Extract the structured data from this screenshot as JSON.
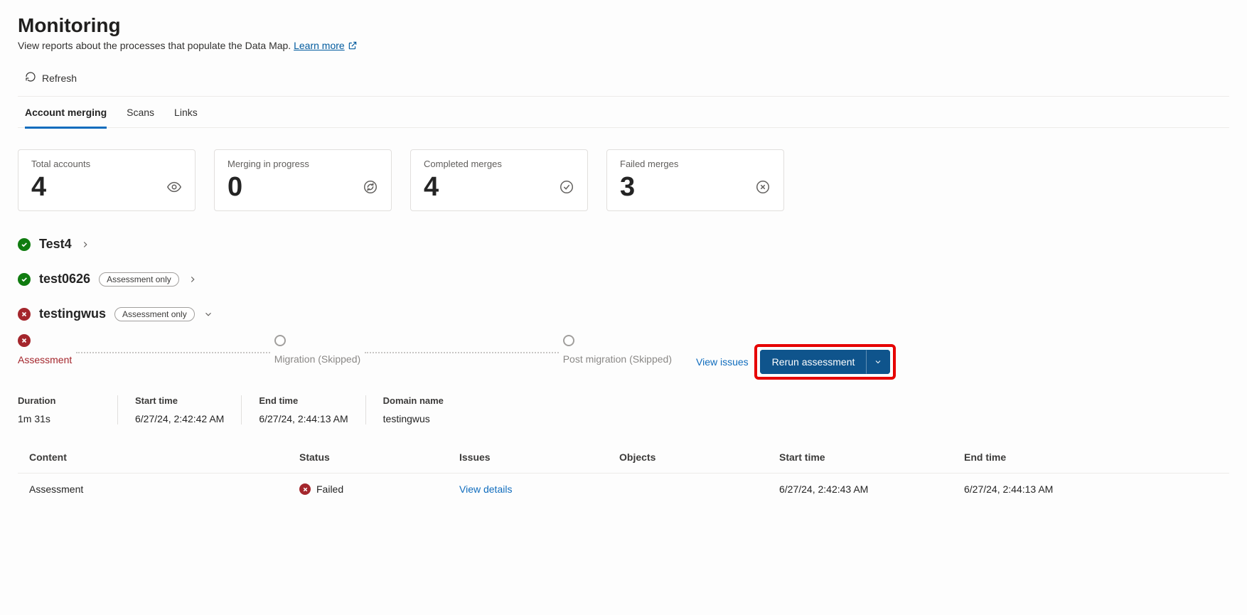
{
  "page": {
    "title": "Monitoring",
    "subtitle": "View reports about the processes that populate the Data Map.",
    "learn_more": "Learn more"
  },
  "toolbar": {
    "refresh": "Refresh"
  },
  "tabs": [
    {
      "label": "Account merging",
      "active": true
    },
    {
      "label": "Scans",
      "active": false
    },
    {
      "label": "Links",
      "active": false
    }
  ],
  "metrics": [
    {
      "label": "Total accounts",
      "value": "4",
      "icon": "eye"
    },
    {
      "label": "Merging in progress",
      "value": "0",
      "icon": "sync"
    },
    {
      "label": "Completed merges",
      "value": "4",
      "icon": "check-circle"
    },
    {
      "label": "Failed merges",
      "value": "3",
      "icon": "x-circle"
    }
  ],
  "accounts": [
    {
      "name": "Test4",
      "status": "success",
      "badge": null,
      "expanded": false
    },
    {
      "name": "test0626",
      "status": "success",
      "badge": "Assessment only",
      "expanded": false
    },
    {
      "name": "testingwus",
      "status": "error",
      "badge": "Assessment only",
      "expanded": true
    }
  ],
  "expanded_detail": {
    "steps": [
      {
        "label": "Assessment",
        "status": "error"
      },
      {
        "label": "Migration (Skipped)",
        "status": "skipped"
      },
      {
        "label": "Post migration (Skipped)",
        "status": "skipped"
      }
    ],
    "view_issues": "View issues",
    "rerun": "Rerun assessment",
    "meta": {
      "duration_label": "Duration",
      "duration_value": "1m 31s",
      "start_label": "Start time",
      "start_value": "6/27/24, 2:42:42 AM",
      "end_label": "End time",
      "end_value": "6/27/24, 2:44:13 AM",
      "domain_label": "Domain name",
      "domain_value": "testingwus"
    },
    "table": {
      "headers": {
        "content": "Content",
        "status": "Status",
        "issues": "Issues",
        "objects": "Objects",
        "start": "Start time",
        "end": "End time"
      },
      "row": {
        "content": "Assessment",
        "status": "Failed",
        "issues": "View details",
        "objects": "",
        "start": "6/27/24, 2:42:43 AM",
        "end": "6/27/24, 2:44:13 AM"
      }
    }
  }
}
